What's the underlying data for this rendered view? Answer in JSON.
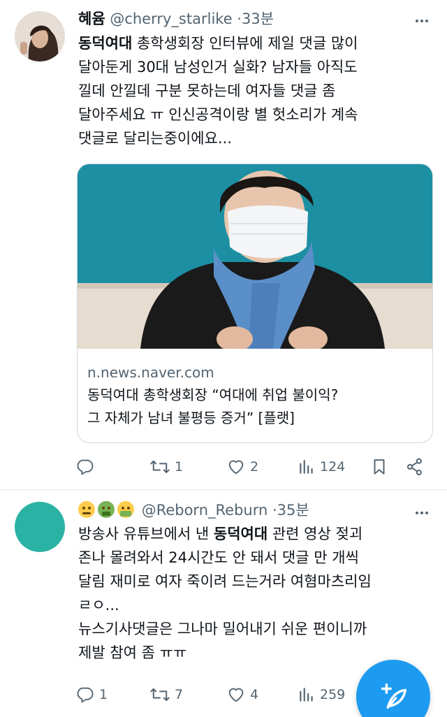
{
  "tweets": [
    {
      "name": "혜윰",
      "handle": "@cherry_starlike",
      "time": "33분",
      "lines": [
        [
          "동덕여대",
          " 총학생회장 인터뷰에 제일 댓글 많이"
        ],
        [
          "",
          "달아둔게 30대 남성인거 실화? 남자들 아직도"
        ],
        [
          "",
          "낄데 안낄데 구분 못하는데 여자들 댓글 좀"
        ],
        [
          "",
          "달아주세요 ㅠ 인신공격이랑 별 헛소리가 계속"
        ],
        [
          "",
          "댓글로 달리는중이에요..."
        ]
      ],
      "card": {
        "domain": "n.news.naver.com",
        "title_line1": "동덕여대 총학생회장 “여대에 취업 불이익?",
        "title_line2": "그 자체가 남녀 불평등 증거” [플랫]"
      },
      "actions": {
        "replies": "",
        "retweets": "1",
        "likes": "2",
        "views": "124"
      }
    },
    {
      "name": "",
      "handle": "@Reborn_Reburn",
      "time": "35분",
      "lines": [
        [
          "",
          "방송사 유튜브에서 낸 ",
          "동덕여대",
          " 관련 영상 젖괴"
        ],
        [
          "",
          "존나 몰려와서 24시간도 안 돼서 댓글 만 개씩"
        ],
        [
          "",
          "달림 재미로 여자 죽이려 드는거라 여혐마츠리임"
        ],
        [
          "",
          "ㄹㅇ..."
        ],
        [
          "",
          "뉴스기사댓글은 그나마 밀어내기 쉬운 편이니까"
        ],
        [
          "",
          "제발 참여 좀 ㅠㅠ"
        ]
      ],
      "actions": {
        "replies": "1",
        "retweets": "7",
        "likes": "4",
        "views": "259"
      }
    }
  ],
  "icons": {
    "reply": "reply-icon",
    "retweet": "retweet-icon",
    "like": "heart-icon",
    "views": "views-icon",
    "bookmark": "bookmark-icon",
    "share": "share-icon",
    "compose": "compose-icon"
  },
  "colors": {
    "accent": "#1d9bf0",
    "secondary_text": "#536471",
    "avatar2": "#2ab3a5"
  }
}
